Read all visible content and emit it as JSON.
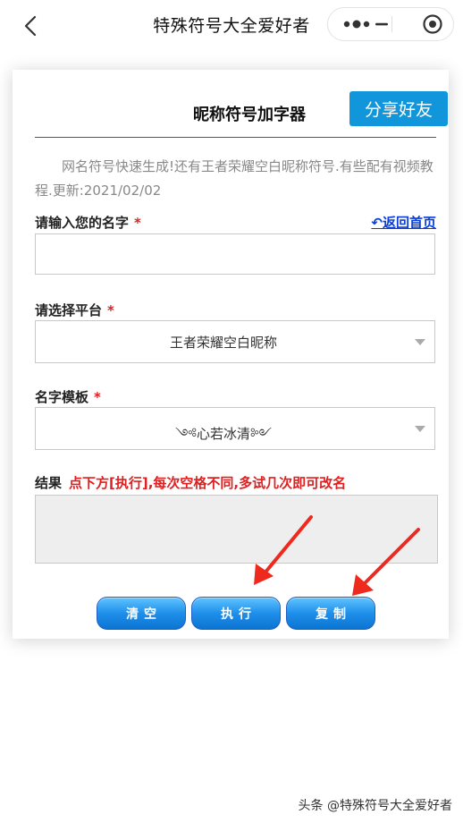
{
  "topbar": {
    "title": "特殊符号大全爱好者"
  },
  "card": {
    "title": "昵称符号加字器",
    "share_label": "分享好友",
    "intro": "网名符号快速生成!还有王者荣耀空白昵称符号.有些配有视频教程.更新:2021/02/02",
    "return_link": "↶返回首页",
    "name_field": {
      "label": "请输入您的名字",
      "required_mark": "*",
      "value": "",
      "placeholder": ""
    },
    "platform_field": {
      "label": "请选择平台",
      "required_mark": "*",
      "selected": "王者荣耀空白昵称"
    },
    "template_field": {
      "label": "名字模板",
      "required_mark": "*",
      "selected": "༺心若冰清༻"
    },
    "result": {
      "label": "结果",
      "hint": "点下方[执行],每次空格不同,多试几次即可改名",
      "value": ""
    },
    "buttons": {
      "clear": "清空",
      "execute": "执行",
      "copy": "复制"
    }
  },
  "watermark": "头条 @特殊符号大全爱好者",
  "colors": {
    "accent": "#1296db",
    "required": "#e02020",
    "link": "#0a3ed6",
    "arrow": "#ee2a1e"
  }
}
